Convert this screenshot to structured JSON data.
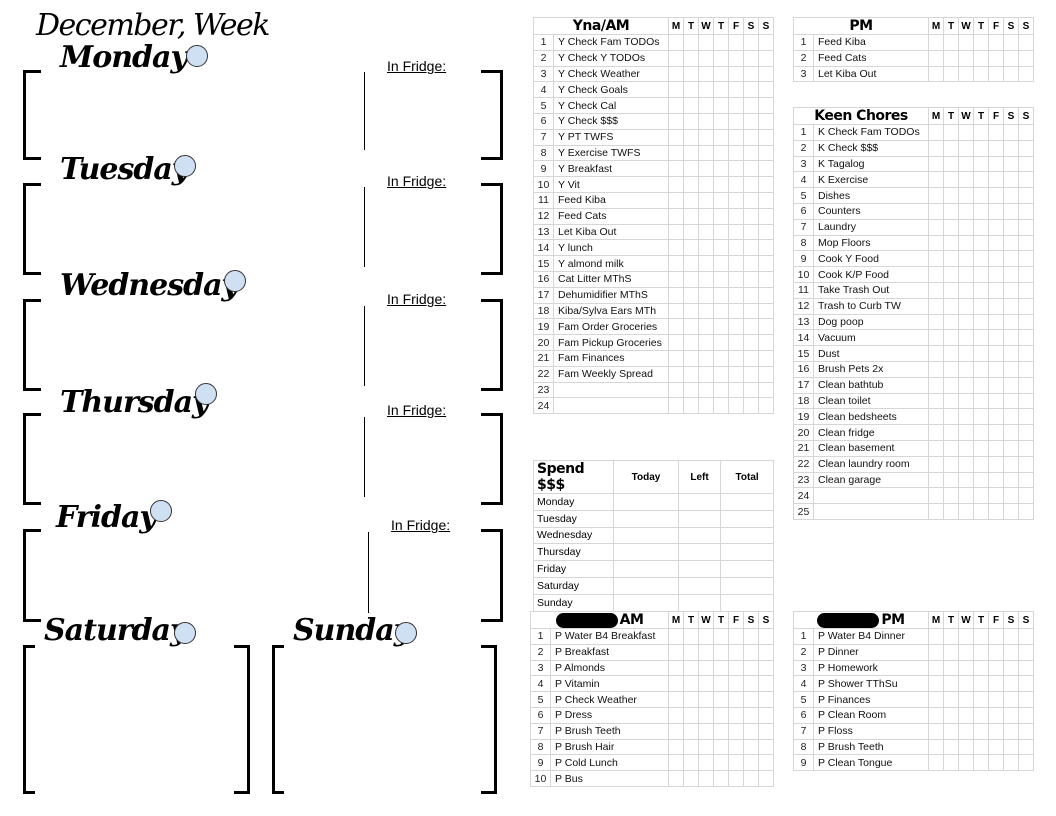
{
  "page": {
    "title": "December, Week"
  },
  "days": [
    {
      "name": "Monday",
      "fridge_label": "In Fridge:"
    },
    {
      "name": "Tuesday",
      "fridge_label": "In Fridge:"
    },
    {
      "name": "Wednesday",
      "fridge_label": "In Fridge:"
    },
    {
      "name": "Thursday",
      "fridge_label": "In Fridge:"
    },
    {
      "name": "Friday",
      "fridge_label": "In Fridge:"
    },
    {
      "name": "Saturday"
    },
    {
      "name": "Sunday"
    }
  ],
  "weekday_headers": [
    "M",
    "T",
    "W",
    "T",
    "F",
    "S",
    "S"
  ],
  "colors": {
    "dot_fill": "#cfe0f2",
    "grid_line": "#d6d6d6"
  },
  "tables": {
    "yna_am": {
      "title": "Yna/AM",
      "rows": [
        "Y Check Fam TODOs",
        "Y Check Y TODOs",
        "Y Check Weather",
        "Y Check Goals",
        "Y Check Cal",
        "Y Check $$$",
        "Y PT TWFS",
        "Y Exercise TWFS",
        "Y Breakfast",
        "Y Vit",
        "Feed Kiba",
        "Feed Cats",
        "Let Kiba Out",
        "Y lunch",
        "Y almond milk",
        "Cat Litter MThS",
        "Dehumidifier MThS",
        "Kiba/Sylva Ears MTh",
        "Fam Order Groceries",
        "Fam Pickup Groceries",
        "Fam Finances",
        "Fam Weekly Spread",
        "",
        ""
      ]
    },
    "pm": {
      "title": "PM",
      "rows": [
        "Feed Kiba",
        "Feed Cats",
        "Let Kiba Out"
      ]
    },
    "keen_chores": {
      "title": "Keen Chores",
      "rows": [
        "K Check Fam TODOs",
        "K Check $$$",
        "K Tagalog",
        "K Exercise",
        "Dishes",
        "Counters",
        "Laundry",
        "Mop Floors",
        "Cook Y Food",
        "Cook K/P Food",
        "Take Trash Out",
        "Trash to Curb TW",
        "Dog poop",
        "Vacuum",
        "Dust",
        "Brush Pets 2x",
        "Clean bathtub",
        "Clean toilet",
        "Clean bedsheets",
        "Clean fridge",
        "Clean basement",
        "Clean laundry room",
        "Clean garage",
        "",
        ""
      ]
    },
    "spend": {
      "title": "Spend $$$",
      "columns": [
        "Today",
        "Left",
        "Total"
      ],
      "rows": [
        "Monday",
        "Tuesday",
        "Wednesday",
        "Thursday",
        "Friday",
        "Saturday",
        "Sunday"
      ]
    },
    "p_am": {
      "title": "AM",
      "rows": [
        "P Water B4 Breakfast",
        "P Breakfast",
        "P Almonds",
        "P Vitamin",
        "P Check Weather",
        "P Dress",
        "P Brush Teeth",
        "P Brush Hair",
        "P Cold Lunch",
        "P Bus"
      ]
    },
    "p_pm": {
      "title": "PM",
      "rows": [
        "P Water B4 Dinner",
        "P Dinner",
        "P Homework",
        "P Shower TThSu",
        "P Finances",
        "P Clean Room",
        "P Floss",
        "P Brush Teeth",
        "P Clean Tongue"
      ]
    }
  }
}
